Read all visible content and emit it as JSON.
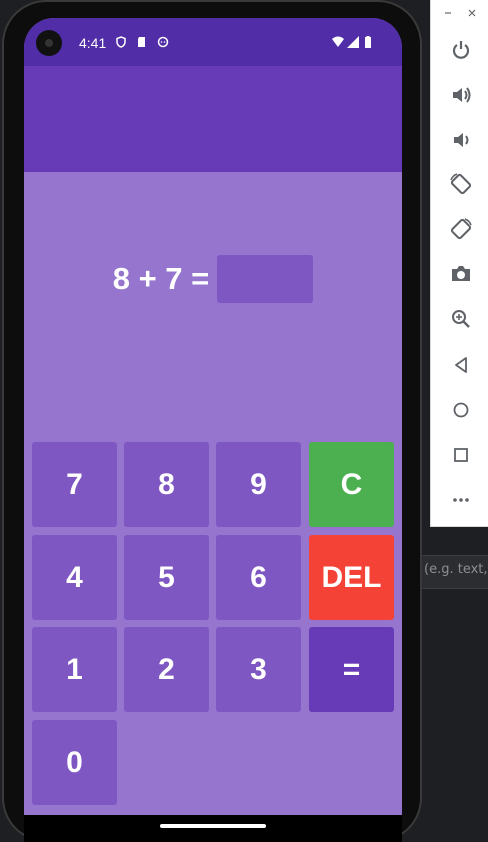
{
  "status_bar": {
    "time": "4:41"
  },
  "equation": {
    "text": "8 + 7 =",
    "answer": ""
  },
  "keypad": {
    "rows": [
      [
        "7",
        "8",
        "9",
        "C"
      ],
      [
        "4",
        "5",
        "6",
        "DEL"
      ],
      [
        "1",
        "2",
        "3",
        "="
      ],
      [
        "0"
      ]
    ]
  },
  "emulator_toolbar": {
    "buttons": [
      "power-icon",
      "volume-up-icon",
      "volume-down-icon",
      "rotate-left-icon",
      "rotate-right-icon",
      "camera-icon",
      "zoom-icon",
      "back-icon",
      "home-icon",
      "overview-icon",
      "more-icon"
    ]
  },
  "ide": {
    "hint_text": "(e.g. text,"
  },
  "colors": {
    "status_bar": "#512da8",
    "app_bar": "#673ab7",
    "background": "#9575cd",
    "key": "#7e57c2",
    "clear_key": "#4caf50",
    "delete_key": "#f44336",
    "equals_key": "#673ab7"
  }
}
